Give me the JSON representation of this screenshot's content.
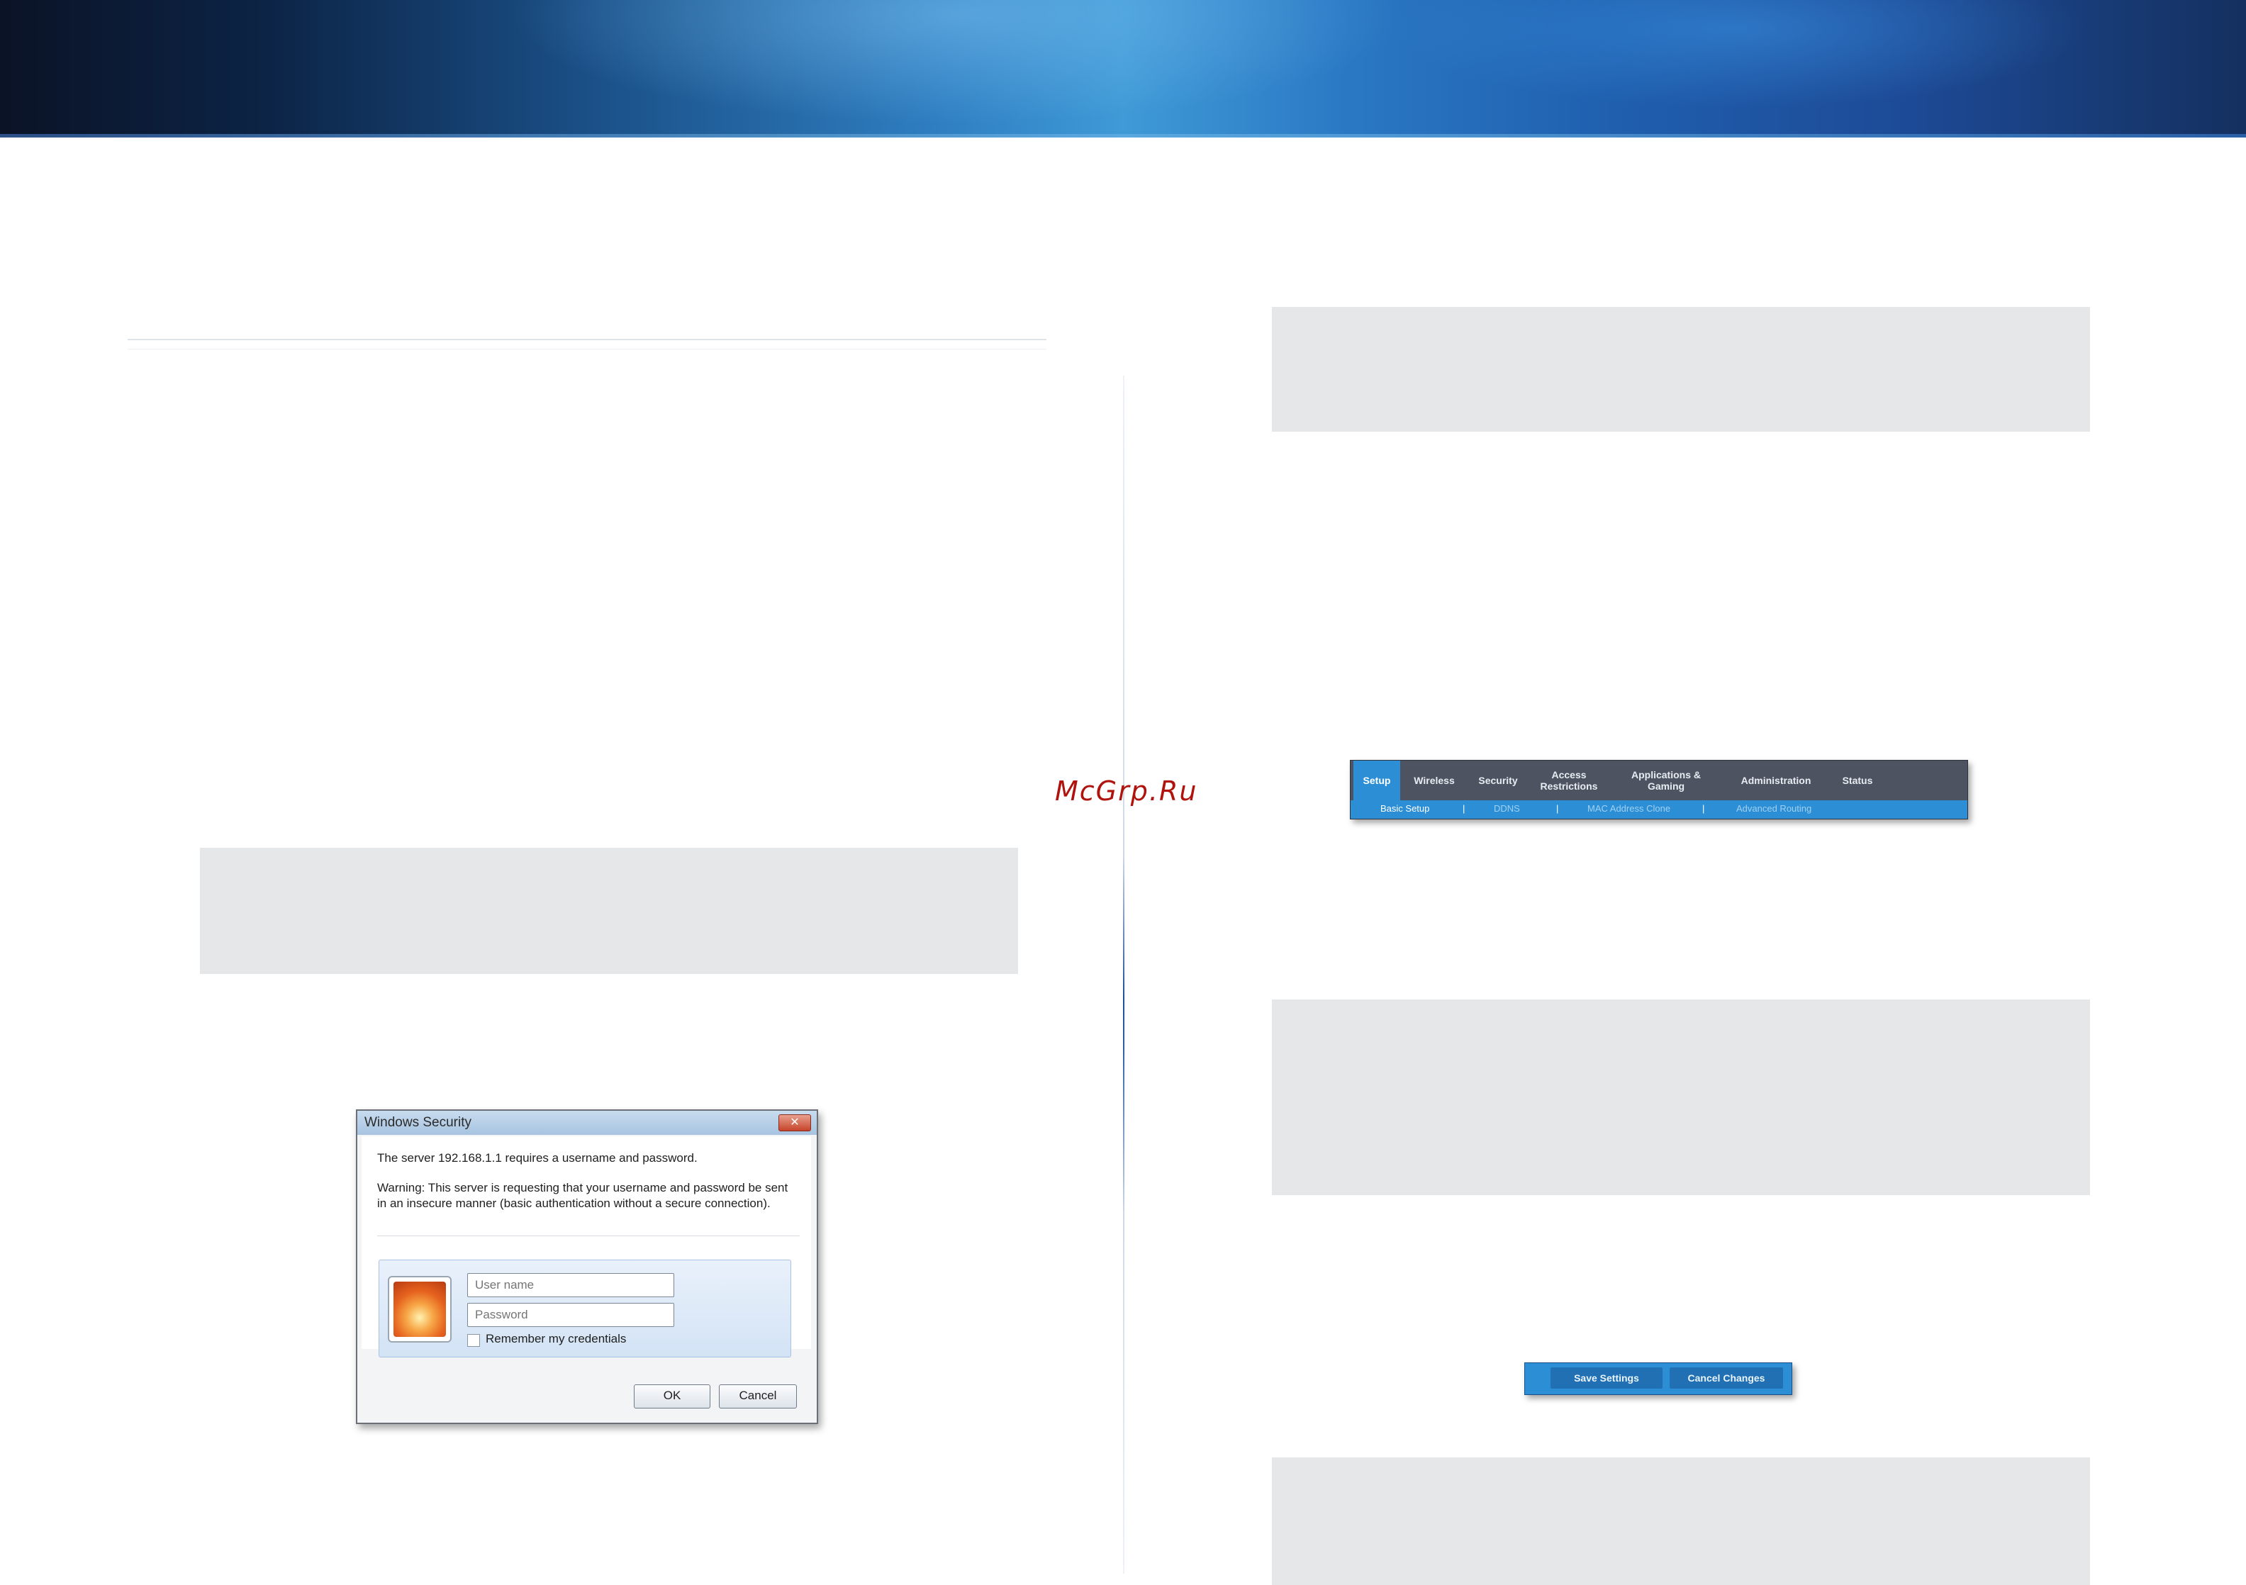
{
  "watermark": "McGrp.Ru",
  "login_dialog": {
    "title": "Windows Security",
    "close_label": "✕",
    "message": "The server 192.168.1.1 requires a username and password.",
    "warning": "Warning: This server is requesting that your username and password be sent in an insecure manner (basic authentication without a secure connection).",
    "username_placeholder": "User name",
    "password_placeholder": "Password",
    "remember_label": "Remember my credentials",
    "ok_label": "OK",
    "cancel_label": "Cancel"
  },
  "router_nav": {
    "tabs": [
      {
        "label": "Setup",
        "active": true
      },
      {
        "label": "Wireless",
        "active": false
      },
      {
        "label": "Security",
        "active": false
      },
      {
        "label": "Access Restrictions",
        "active": false
      },
      {
        "label": "Applications & Gaming",
        "active": false
      },
      {
        "label": "Administration",
        "active": false
      },
      {
        "label": "Status",
        "active": false
      }
    ],
    "subtabs": [
      {
        "label": "Basic Setup",
        "active": true
      },
      {
        "label": "DDNS",
        "active": false
      },
      {
        "label": "MAC Address Clone",
        "active": false
      },
      {
        "label": "Advanced Routing",
        "active": false
      }
    ],
    "separator": "|"
  },
  "action_bar": {
    "save_label": "Save Settings",
    "cancel_label": "Cancel Changes"
  },
  "colors": {
    "accent_blue": "#2c8fd6",
    "nav_gray": "#4d5361",
    "note_gray": "#e6e7e9"
  }
}
